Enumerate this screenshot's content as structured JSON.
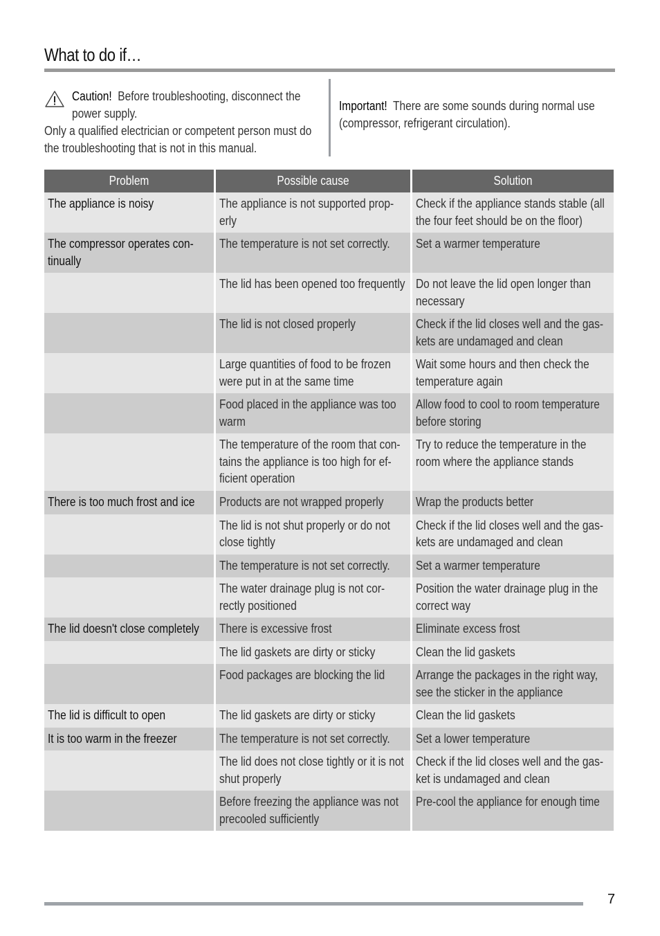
{
  "page": {
    "title": "What to do if…",
    "page_number": "7"
  },
  "caution": {
    "icon": "warning-triangle-icon",
    "label": "Caution!",
    "line1": "Before troubleshooting, disconnect the",
    "line2": "power supply.",
    "line3": "Only a qualified electrician or competent person must do",
    "line4": "the troubleshooting that is not in this manual."
  },
  "important": {
    "label": "Important!",
    "line1": "There are some sounds during normal use",
    "line2": "(compressor, refrigerant circulation)."
  },
  "table": {
    "headers": [
      "Problem",
      "Possible cause",
      "Solution"
    ],
    "rows": [
      {
        "problem": "The appliance is noisy",
        "cause": "The appliance is not supported prop-erly",
        "solution": "Check if the appliance stands stable (all the four feet should be on the floor)"
      },
      {
        "problem": "The compressor operates con-tinually",
        "cause": "The temperature is not set correctly.",
        "solution": "Set a warmer temperature"
      },
      {
        "problem": "",
        "cause": "The lid has been opened too frequently",
        "solution": "Do not leave the lid open longer than necessary"
      },
      {
        "problem": "",
        "cause": "The lid is not closed properly",
        "solution": "Check if the lid closes well and the gas-kets are undamaged and clean"
      },
      {
        "problem": "",
        "cause": "Large quantities of food to be frozen were put in at the same time",
        "solution": "Wait some hours and then check the temperature again"
      },
      {
        "problem": "",
        "cause": "Food placed in the appliance was too warm",
        "solution": "Allow food to cool to room temperature before storing"
      },
      {
        "problem": "",
        "cause": "The temperature of the room that con-tains the appliance is too high for ef-ficient operation",
        "solution": "Try to reduce the temperature in the room where the appliance stands"
      },
      {
        "problem": "There is too much frost and ice",
        "cause": "Products are not wrapped properly",
        "solution": "Wrap the products better"
      },
      {
        "problem": "",
        "cause": "The lid is not shut properly or do not close tightly",
        "solution": "Check if the lid closes well and the gas-kets are undamaged and clean"
      },
      {
        "problem": "",
        "cause": "The temperature is not set correctly.",
        "solution": "Set a warmer temperature"
      },
      {
        "problem": "",
        "cause": "The water drainage plug is not cor-rectly positioned",
        "solution": "Position the water drainage plug in the correct way"
      },
      {
        "problem": "The lid doesn't close completely",
        "cause": "There is excessive frost",
        "solution": "Eliminate excess frost"
      },
      {
        "problem": "",
        "cause": "The lid gaskets are dirty or sticky",
        "solution": "Clean the lid gaskets"
      },
      {
        "problem": "",
        "cause": "Food packages are blocking the lid",
        "solution": "Arrange the packages in the right way, see the sticker in the appliance"
      },
      {
        "problem": "The lid is difficult to open",
        "cause": "The lid gaskets are dirty or sticky",
        "solution": "Clean the lid gaskets"
      },
      {
        "problem": "It is too warm in the freezer",
        "cause": "The temperature is not set correctly.",
        "solution": "Set a lower temperature"
      },
      {
        "problem": "",
        "cause": "The lid does not close tightly or it is not shut properly",
        "solution": "Check if the lid closes well and the gas-ket is undamaged and clean"
      },
      {
        "problem": "",
        "cause": "Before freezing the appliance was not precooled sufficiently",
        "solution": "Pre-cool the appliance for enough time"
      }
    ]
  }
}
